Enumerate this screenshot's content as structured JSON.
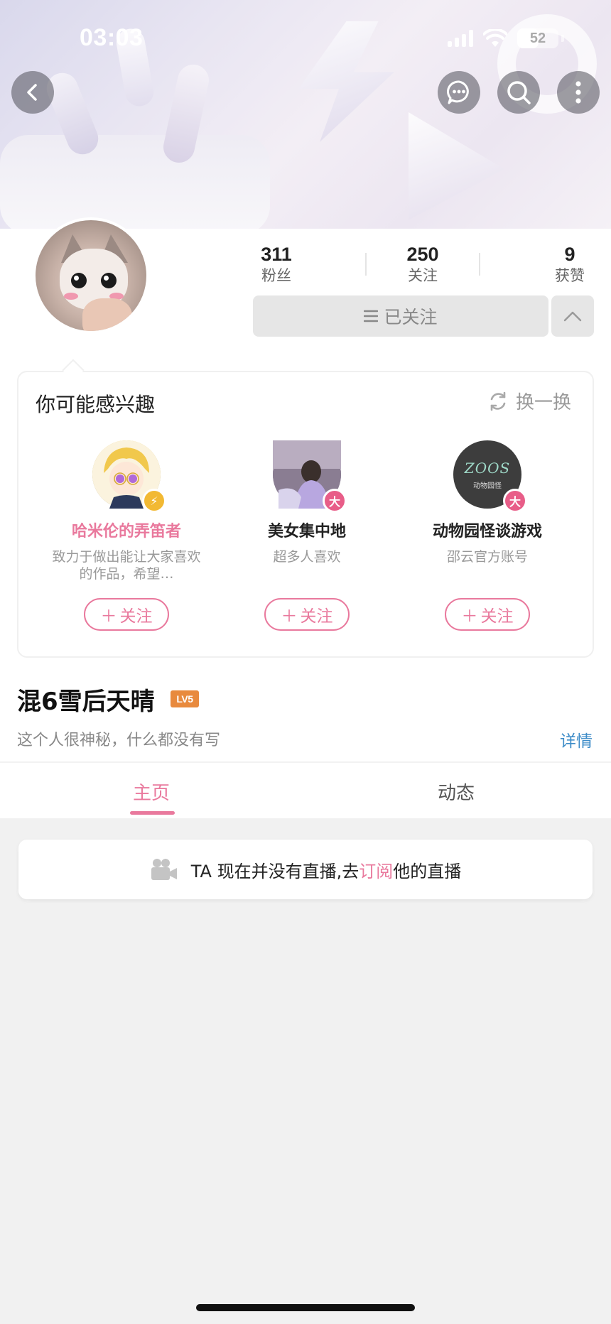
{
  "status_bar": {
    "time": "03:03",
    "battery": "52",
    "battery_level": 0.52,
    "icons": [
      "signal-icon",
      "wifi-icon",
      "battery-icon"
    ]
  },
  "top_bar": {
    "icons": [
      "back-icon",
      "chat-icon",
      "search-icon",
      "more-icon"
    ]
  },
  "profile": {
    "fans_count": "311",
    "fans_label": "粉丝",
    "following_count": "250",
    "following_label": "关注",
    "likes_count": "9",
    "likes_label": "获赞",
    "followed_label": "已关注",
    "username": "混6雪后天晴",
    "level": "LV5",
    "bio": "这个人很神秘，什么都没有写",
    "detail_label": "详情"
  },
  "recommendations": {
    "title": "你可能感兴趣",
    "refresh_label": "换一换",
    "follow_label": "关注",
    "items": [
      {
        "name": "哈米伦的弄笛者",
        "desc": "致力于做出能让大家喜欢的作品，希望…",
        "badge": "⚡",
        "badge_color": "#f2b933",
        "name_color": "#e9799d"
      },
      {
        "name": "美女集中地",
        "desc": "超多人喜欢",
        "badge": "大",
        "badge_color": "#e85d88",
        "name_color": "#222222"
      },
      {
        "name": "动物园怪谈游戏",
        "desc": "邵云官方账号",
        "badge": "大",
        "badge_color": "#e85d88",
        "name_color": "#222222",
        "avatar_text": "ZOOS",
        "avatar_subtext": "动物园怪"
      }
    ]
  },
  "tabs": {
    "home": "主页",
    "activity": "动态"
  },
  "live_notice": {
    "prefix": "TA 现在并没有直播,去",
    "link": "订阅",
    "suffix": "他的直播"
  },
  "colors": {
    "accent": "#e9799d",
    "link_blue": "#3d8cc8",
    "level_orange": "#e88a3e",
    "page_bg": "#f1f1f1"
  }
}
